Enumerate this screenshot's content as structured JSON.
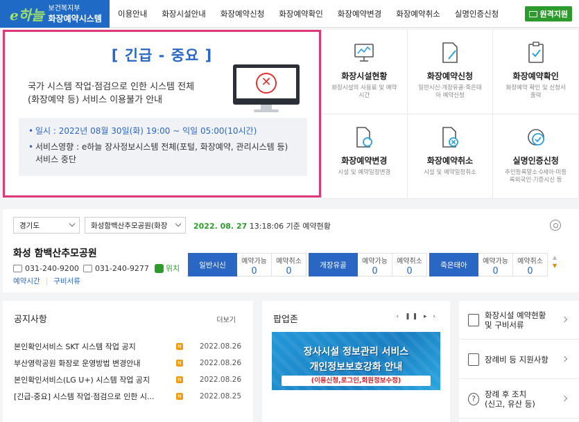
{
  "header": {
    "logo_mark": "e하늘",
    "logo_line1": "보건복지부",
    "logo_line2": "화장예약시스템",
    "nav": [
      "이용안내",
      "화장시설안내",
      "화장예약신청",
      "화장예약확인",
      "화장예약변경",
      "화장예약취소",
      "실명인증신청"
    ],
    "remote_button": "원격지원"
  },
  "notice": {
    "title": "[ 긴급 - 중요 ]",
    "message_line1": "국가 시스템 작업·점검으로 인한 시스템 전체",
    "message_line2": "(화장예약 등) 서비스 이용불가 안내",
    "schedule": "일시 : 2022년 08월 30일(화) 19:00 ~ 익일 05:00(10시간)",
    "impact": "서비스영향 : e하늘 장사정보시스템 전체(포털, 화장예약, 관리시스템 등) 서비스 중단"
  },
  "services": [
    {
      "title": "화장시설현황",
      "desc": "화장시설의 사용료 및 예약시간",
      "icon": "chart-monitor-icon"
    },
    {
      "title": "화장예약신청",
      "desc": "일반시신·개장유골·죽은태아 예약신청",
      "icon": "document-pen-icon"
    },
    {
      "title": "화장예약확인",
      "desc": "화장예약 확인 및 신청서 출력",
      "icon": "clipboard-check-icon"
    },
    {
      "title": "화장예약변경",
      "desc": "시설 및 예약일정변경",
      "icon": "document-refresh-icon"
    },
    {
      "title": "화장예약취소",
      "desc": "시설 및 예약일정취소",
      "icon": "document-cancel-icon"
    },
    {
      "title": "실명인증신청",
      "desc": "주민등록말소·0세아·미등록외국인·기증시신 등",
      "icon": "badge-check-icon"
    }
  ],
  "status": {
    "region": "경기도",
    "facility_select": "화성함백산추모공원(화장",
    "date": "2022. 08. 27",
    "time_suffix": "13:18:06 기준 예약현황",
    "place_name": "화성 함백산추모공원",
    "phone": "031-240-9200",
    "fax": "031-240-9277",
    "location_label": "위치",
    "link_hours": "예약시간",
    "link_docs": "구비서류",
    "stat_available": "예약가능",
    "stat_cancel": "예약취소",
    "types": [
      {
        "name": "일반시신",
        "available": "0",
        "cancel": "0"
      },
      {
        "name": "개장유골",
        "available": "0",
        "cancel": "0"
      },
      {
        "name": "죽은태아",
        "available": "0",
        "cancel": "0"
      }
    ]
  },
  "notices": {
    "title": "공지사항",
    "more": "더보기",
    "new_badge": "N",
    "items": [
      {
        "title": "본인확인서비스 SKT 시스템 작업 공지",
        "date": "2022.08.26"
      },
      {
        "title": "부산영락공원 화장로 운영방법 변경안내",
        "date": "2022.08.26"
      },
      {
        "title": "본인확인서비스(LG U+) 시스템 작업 공지",
        "date": "2022.08.26"
      },
      {
        "title": "[긴급-중요] 시스템 작업·점검으로 인한 시...",
        "date": "2022.08.25"
      }
    ]
  },
  "popup": {
    "title": "팝업존",
    "controls": "‹ ❚❚ ▸ ›",
    "banner_line1": "장사시설 정보관리 서비스",
    "banner_line2": "개인정보보호강화 안내",
    "banner_line3": "(이용신청,로그인,회원정보수정)"
  },
  "links": [
    {
      "line1": "화장시설 예약현황",
      "line2": "및 구비서류",
      "icon": "document-check-icon"
    },
    {
      "line1": "장례비 등 지원사항",
      "line2": "",
      "icon": "document-list-icon"
    },
    {
      "line1": "장례 후 조치",
      "line2": "(신고, 유산 등)",
      "icon": "question-icon"
    }
  ]
}
